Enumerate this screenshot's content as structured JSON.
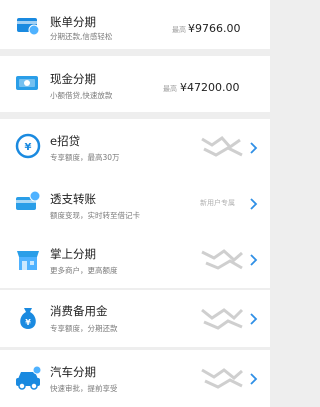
{
  "items": [
    {
      "title": "账单分期",
      "subtitle": "分期还款,信感轻松",
      "right_label": "最高",
      "amount": "¥9766.00",
      "icon": "bill-installment-icon"
    },
    {
      "title": "现金分期",
      "subtitle": "小额借贷,快速放款",
      "right_label": "最高",
      "amount": "¥47200.00",
      "icon": "cash-installment-icon"
    },
    {
      "title": "e招贷",
      "subtitle": "专享额度，最高30万",
      "icon": "yen-loan-icon"
    },
    {
      "title": "透支转账",
      "subtitle": "额度变现，实时转至借记卡",
      "right_label": "新用户专属",
      "icon": "overdraft-transfer-icon"
    },
    {
      "title": "掌上分期",
      "subtitle": "更多商户，更高额度",
      "icon": "shop-installment-icon"
    },
    {
      "title": "消费备用金",
      "subtitle": "专享额度，分期还款",
      "icon": "money-bag-icon"
    },
    {
      "title": "汽车分期",
      "subtitle": "快速审批，提前享受",
      "icon": "car-icon"
    }
  ],
  "colors": {
    "accent": "#1a8ae0",
    "chevron": "#2f8fe6"
  }
}
